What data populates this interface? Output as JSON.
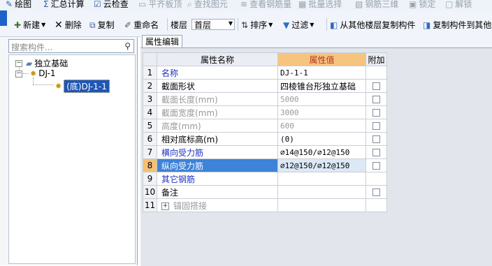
{
  "toolbar_top": {
    "items": [
      {
        "icon": "draw-icon",
        "glyph": "✎",
        "label": "绘图",
        "disabled": false
      },
      {
        "icon": "sigma-icon",
        "glyph": "Σ",
        "label": "汇总计算",
        "disabled": false
      },
      {
        "icon": "check-icon",
        "glyph": "☑",
        "label": "云检查",
        "disabled": false
      },
      {
        "icon": "flat-slab-icon",
        "glyph": "▭",
        "label": "平齐板顶",
        "disabled": true
      },
      {
        "icon": "find-icon",
        "glyph": "⌕",
        "label": "查找图元",
        "disabled": true
      },
      {
        "icon": "view-rebar-icon",
        "glyph": "≋",
        "label": "查看钢筋量",
        "disabled": true
      },
      {
        "icon": "batch-select-icon",
        "glyph": "▦",
        "label": "批量选择",
        "disabled": true
      },
      {
        "icon": "rebar-3d-icon",
        "glyph": "▧",
        "label": "钢筋三维",
        "disabled": true
      },
      {
        "icon": "lock-icon",
        "glyph": "▣",
        "label": "锁定",
        "disabled": true
      },
      {
        "icon": "unlock-icon",
        "glyph": "▢",
        "label": "解锁",
        "disabled": true
      }
    ]
  },
  "toolbar_main": {
    "new_label": "新建",
    "delete_label": "删除",
    "copy_label": "复制",
    "rename_label": "重命名",
    "floor_label": "楼层",
    "floor_value": "首层",
    "sort_label": "排序",
    "filter_label": "过滤",
    "copy_from_floor_label": "从其他楼层复制构件",
    "copy_to_floor_label": "复制构件到其他"
  },
  "left_panel": {
    "search_placeholder": "搜索构件...",
    "tree": {
      "root_label": "独立基础",
      "child_label": "DJ-1",
      "leaf_label": "(底)DJ-1-1"
    }
  },
  "properties": {
    "tab_label": "属性编辑",
    "columns": {
      "name": "属性名称",
      "value": "属性值",
      "extra": "附加"
    },
    "rows": [
      {
        "num": "1",
        "name": "名称",
        "value": "DJ-1-1",
        "style": "blue",
        "checkbox": false
      },
      {
        "num": "2",
        "name": "截面形状",
        "value": "四棱锥台形独立基础",
        "style": "normal",
        "checkbox": true
      },
      {
        "num": "3",
        "name": "截面长度(mm)",
        "value": "5000",
        "style": "gray",
        "checkbox": true
      },
      {
        "num": "4",
        "name": "截面宽度(mm)",
        "value": "3000",
        "style": "gray",
        "checkbox": true
      },
      {
        "num": "5",
        "name": "高度(mm)",
        "value": "600",
        "style": "gray",
        "checkbox": true
      },
      {
        "num": "6",
        "name": "相对底标高(m)",
        "value": "(0)",
        "style": "normal",
        "checkbox": true
      },
      {
        "num": "7",
        "name": "横向受力筋",
        "value": "⌀14@150/⌀12@150",
        "style": "blue",
        "checkbox": true
      },
      {
        "num": "8",
        "name": "纵向受力筋",
        "value": "⌀12@150/⌀12@150",
        "style": "highlight",
        "checkbox": true
      },
      {
        "num": "9",
        "name": "其它钢筋",
        "value": "",
        "style": "blue",
        "checkbox": false
      },
      {
        "num": "10",
        "name": "备注",
        "value": "",
        "style": "normal",
        "checkbox": true
      },
      {
        "num": "11",
        "name": "锚固搭接",
        "value": "",
        "style": "gray-expand",
        "checkbox": false
      }
    ]
  }
}
